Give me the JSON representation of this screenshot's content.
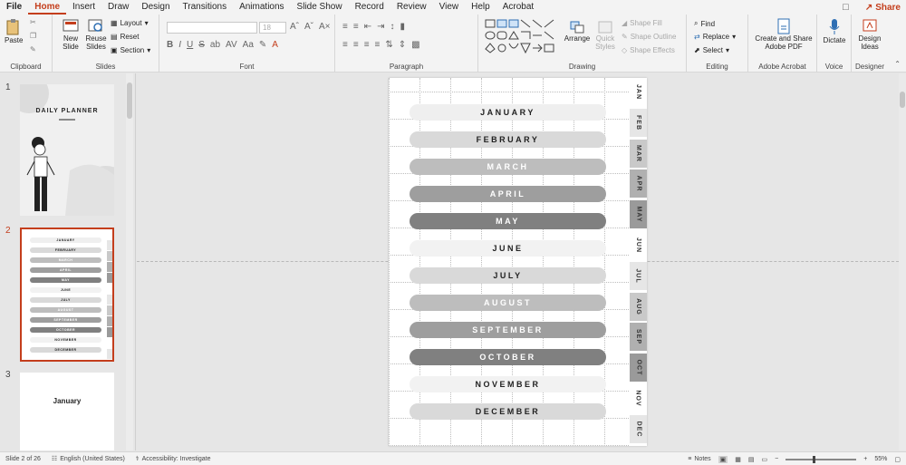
{
  "menu": {
    "tabs": [
      "File",
      "Home",
      "Insert",
      "Draw",
      "Design",
      "Transitions",
      "Animations",
      "Slide Show",
      "Record",
      "Review",
      "View",
      "Help",
      "Acrobat"
    ],
    "active": "Home",
    "share": "Share"
  },
  "ribbon": {
    "clipboard": {
      "paste": "Paste",
      "label": "Clipboard"
    },
    "slides": {
      "new_slide": "New Slide",
      "reuse_slides": "Reuse Slides",
      "layout": "Layout",
      "reset": "Reset",
      "section": "Section",
      "label": "Slides"
    },
    "font": {
      "label": "Font",
      "size": "18"
    },
    "paragraph": {
      "label": "Paragraph"
    },
    "drawing": {
      "arrange": "Arrange",
      "quick_styles": "Quick Styles",
      "shape_fill": "Shape Fill",
      "shape_outline": "Shape Outline",
      "shape_effects": "Shape Effects",
      "label": "Drawing"
    },
    "editing": {
      "find": "Find",
      "replace": "Replace",
      "select": "Select",
      "label": "Editing"
    },
    "acrobat": {
      "create_share": "Create and Share Adobe PDF",
      "label": "Adobe Acrobat"
    },
    "voice": {
      "dictate": "Dictate",
      "label": "Voice"
    },
    "designer": {
      "design_ideas": "Design Ideas",
      "label": "Designer"
    }
  },
  "thumbnails": [
    {
      "number": "1",
      "title": "DAILY PLANNER"
    },
    {
      "number": "2",
      "title": ""
    },
    {
      "number": "3",
      "title": "January"
    }
  ],
  "slide": {
    "months": [
      {
        "label": "JANUARY",
        "shade": "#efefef",
        "text": "#222222"
      },
      {
        "label": "FEBRUARY",
        "shade": "#d9d9d9",
        "text": "#222222"
      },
      {
        "label": "MARCH",
        "shade": "#bdbdbd",
        "text": "#ffffff"
      },
      {
        "label": "APRIL",
        "shade": "#9e9e9e",
        "text": "#ffffff"
      },
      {
        "label": "MAY",
        "shade": "#808080",
        "text": "#ffffff"
      },
      {
        "label": "JUNE",
        "shade": "#f2f2f2",
        "text": "#222222"
      },
      {
        "label": "JULY",
        "shade": "#d9d9d9",
        "text": "#222222"
      },
      {
        "label": "AUGUST",
        "shade": "#bdbdbd",
        "text": "#ffffff"
      },
      {
        "label": "SEPTEMBER",
        "shade": "#9e9e9e",
        "text": "#ffffff"
      },
      {
        "label": "OCTOBER",
        "shade": "#808080",
        "text": "#ffffff"
      },
      {
        "label": "NOVEMBER",
        "shade": "#f2f2f2",
        "text": "#222222"
      },
      {
        "label": "DECEMBER",
        "shade": "#d9d9d9",
        "text": "#222222"
      }
    ],
    "tabs": [
      {
        "label": "JAN",
        "shade": "#ffffff"
      },
      {
        "label": "FEB",
        "shade": "#e6e6e6"
      },
      {
        "label": "MAR",
        "shade": "#c9c9c9"
      },
      {
        "label": "APR",
        "shade": "#b0b0b0"
      },
      {
        "label": "MAY",
        "shade": "#9a9a9a"
      },
      {
        "label": "JUN",
        "shade": "#ffffff"
      },
      {
        "label": "JUL",
        "shade": "#e6e6e6"
      },
      {
        "label": "AUG",
        "shade": "#c9c9c9"
      },
      {
        "label": "SEP",
        "shade": "#b0b0b0"
      },
      {
        "label": "OCT",
        "shade": "#9a9a9a"
      },
      {
        "label": "NOV",
        "shade": "#ffffff"
      },
      {
        "label": "DEC",
        "shade": "#e6e6e6"
      }
    ]
  },
  "status": {
    "slide_count": "Slide 2 of 26",
    "language": "English (United States)",
    "accessibility": "Accessibility: Investigate",
    "notes": "Notes",
    "zoom": "55%"
  },
  "colors": {
    "accent": "#c43e1c",
    "ribbon_bg": "#f3f3f3",
    "canvas_bg": "#e6e6e6"
  }
}
